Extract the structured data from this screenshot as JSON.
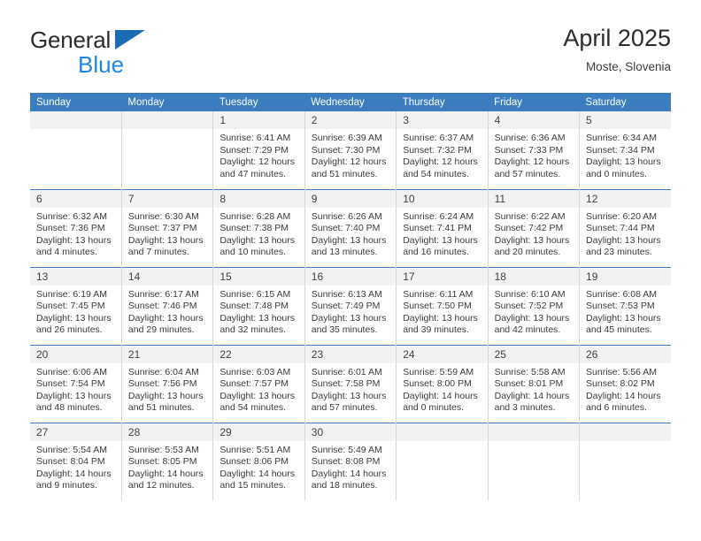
{
  "brand": {
    "name_top": "General",
    "name_bottom": "Blue",
    "triangle_color": "#1b6cb5",
    "blue_text_color": "#1f87e0"
  },
  "header": {
    "title": "April 2025",
    "subtitle": "Moste, Slovenia"
  },
  "theme": {
    "header_bg": "#3b7dbf",
    "header_text": "#ffffff",
    "daynum_bg": "#f2f2f2",
    "row_divider": "#3b7dbf",
    "cell_divider": "#d7d7d7"
  },
  "weekdays": [
    "Sunday",
    "Monday",
    "Tuesday",
    "Wednesday",
    "Thursday",
    "Friday",
    "Saturday"
  ],
  "labels": {
    "sunrise_prefix": "Sunrise:",
    "sunset_prefix": "Sunset:",
    "daylight_prefix": "Daylight:"
  },
  "weeks": [
    [
      {
        "day": "",
        "lines": []
      },
      {
        "day": "",
        "lines": []
      },
      {
        "day": "1",
        "lines": [
          "Sunrise: 6:41 AM",
          "Sunset: 7:29 PM",
          "Daylight: 12 hours",
          "and 47 minutes."
        ]
      },
      {
        "day": "2",
        "lines": [
          "Sunrise: 6:39 AM",
          "Sunset: 7:30 PM",
          "Daylight: 12 hours",
          "and 51 minutes."
        ]
      },
      {
        "day": "3",
        "lines": [
          "Sunrise: 6:37 AM",
          "Sunset: 7:32 PM",
          "Daylight: 12 hours",
          "and 54 minutes."
        ]
      },
      {
        "day": "4",
        "lines": [
          "Sunrise: 6:36 AM",
          "Sunset: 7:33 PM",
          "Daylight: 12 hours",
          "and 57 minutes."
        ]
      },
      {
        "day": "5",
        "lines": [
          "Sunrise: 6:34 AM",
          "Sunset: 7:34 PM",
          "Daylight: 13 hours",
          "and 0 minutes."
        ]
      }
    ],
    [
      {
        "day": "6",
        "lines": [
          "Sunrise: 6:32 AM",
          "Sunset: 7:36 PM",
          "Daylight: 13 hours",
          "and 4 minutes."
        ]
      },
      {
        "day": "7",
        "lines": [
          "Sunrise: 6:30 AM",
          "Sunset: 7:37 PM",
          "Daylight: 13 hours",
          "and 7 minutes."
        ]
      },
      {
        "day": "8",
        "lines": [
          "Sunrise: 6:28 AM",
          "Sunset: 7:38 PM",
          "Daylight: 13 hours",
          "and 10 minutes."
        ]
      },
      {
        "day": "9",
        "lines": [
          "Sunrise: 6:26 AM",
          "Sunset: 7:40 PM",
          "Daylight: 13 hours",
          "and 13 minutes."
        ]
      },
      {
        "day": "10",
        "lines": [
          "Sunrise: 6:24 AM",
          "Sunset: 7:41 PM",
          "Daylight: 13 hours",
          "and 16 minutes."
        ]
      },
      {
        "day": "11",
        "lines": [
          "Sunrise: 6:22 AM",
          "Sunset: 7:42 PM",
          "Daylight: 13 hours",
          "and 20 minutes."
        ]
      },
      {
        "day": "12",
        "lines": [
          "Sunrise: 6:20 AM",
          "Sunset: 7:44 PM",
          "Daylight: 13 hours",
          "and 23 minutes."
        ]
      }
    ],
    [
      {
        "day": "13",
        "lines": [
          "Sunrise: 6:19 AM",
          "Sunset: 7:45 PM",
          "Daylight: 13 hours",
          "and 26 minutes."
        ]
      },
      {
        "day": "14",
        "lines": [
          "Sunrise: 6:17 AM",
          "Sunset: 7:46 PM",
          "Daylight: 13 hours",
          "and 29 minutes."
        ]
      },
      {
        "day": "15",
        "lines": [
          "Sunrise: 6:15 AM",
          "Sunset: 7:48 PM",
          "Daylight: 13 hours",
          "and 32 minutes."
        ]
      },
      {
        "day": "16",
        "lines": [
          "Sunrise: 6:13 AM",
          "Sunset: 7:49 PM",
          "Daylight: 13 hours",
          "and 35 minutes."
        ]
      },
      {
        "day": "17",
        "lines": [
          "Sunrise: 6:11 AM",
          "Sunset: 7:50 PM",
          "Daylight: 13 hours",
          "and 39 minutes."
        ]
      },
      {
        "day": "18",
        "lines": [
          "Sunrise: 6:10 AM",
          "Sunset: 7:52 PM",
          "Daylight: 13 hours",
          "and 42 minutes."
        ]
      },
      {
        "day": "19",
        "lines": [
          "Sunrise: 6:08 AM",
          "Sunset: 7:53 PM",
          "Daylight: 13 hours",
          "and 45 minutes."
        ]
      }
    ],
    [
      {
        "day": "20",
        "lines": [
          "Sunrise: 6:06 AM",
          "Sunset: 7:54 PM",
          "Daylight: 13 hours",
          "and 48 minutes."
        ]
      },
      {
        "day": "21",
        "lines": [
          "Sunrise: 6:04 AM",
          "Sunset: 7:56 PM",
          "Daylight: 13 hours",
          "and 51 minutes."
        ]
      },
      {
        "day": "22",
        "lines": [
          "Sunrise: 6:03 AM",
          "Sunset: 7:57 PM",
          "Daylight: 13 hours",
          "and 54 minutes."
        ]
      },
      {
        "day": "23",
        "lines": [
          "Sunrise: 6:01 AM",
          "Sunset: 7:58 PM",
          "Daylight: 13 hours",
          "and 57 minutes."
        ]
      },
      {
        "day": "24",
        "lines": [
          "Sunrise: 5:59 AM",
          "Sunset: 8:00 PM",
          "Daylight: 14 hours",
          "and 0 minutes."
        ]
      },
      {
        "day": "25",
        "lines": [
          "Sunrise: 5:58 AM",
          "Sunset: 8:01 PM",
          "Daylight: 14 hours",
          "and 3 minutes."
        ]
      },
      {
        "day": "26",
        "lines": [
          "Sunrise: 5:56 AM",
          "Sunset: 8:02 PM",
          "Daylight: 14 hours",
          "and 6 minutes."
        ]
      }
    ],
    [
      {
        "day": "27",
        "lines": [
          "Sunrise: 5:54 AM",
          "Sunset: 8:04 PM",
          "Daylight: 14 hours",
          "and 9 minutes."
        ]
      },
      {
        "day": "28",
        "lines": [
          "Sunrise: 5:53 AM",
          "Sunset: 8:05 PM",
          "Daylight: 14 hours",
          "and 12 minutes."
        ]
      },
      {
        "day": "29",
        "lines": [
          "Sunrise: 5:51 AM",
          "Sunset: 8:06 PM",
          "Daylight: 14 hours",
          "and 15 minutes."
        ]
      },
      {
        "day": "30",
        "lines": [
          "Sunrise: 5:49 AM",
          "Sunset: 8:08 PM",
          "Daylight: 14 hours",
          "and 18 minutes."
        ]
      },
      {
        "day": "",
        "lines": []
      },
      {
        "day": "",
        "lines": []
      },
      {
        "day": "",
        "lines": []
      }
    ]
  ]
}
